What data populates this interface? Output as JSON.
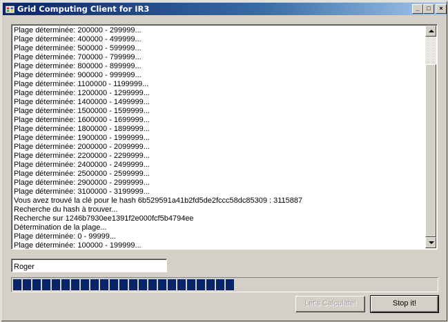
{
  "window": {
    "title": "Grid Computing Client for IR3",
    "controls": {
      "minimize": "_",
      "maximize": "□",
      "close": "×"
    }
  },
  "log": {
    "lines": [
      "Plage déterminée: 200000 - 299999...",
      "Plage déterminée: 400000 - 499999...",
      "Plage déterminée: 500000 - 599999...",
      "Plage déterminée: 700000 - 799999...",
      "Plage déterminée: 800000 - 899999...",
      "Plage déterminée: 900000 - 999999...",
      "Plage déterminée: 1100000 - 1199999...",
      "Plage déterminée: 1200000 - 1299999...",
      "Plage déterminée: 1400000 - 1499999...",
      "Plage déterminée: 1500000 - 1599999...",
      "Plage déterminée: 1600000 - 1699999...",
      "Plage déterminée: 1800000 - 1899999...",
      "Plage déterminée: 1900000 - 1999999...",
      "Plage déterminée: 2000000 - 2099999...",
      "Plage déterminée: 2200000 - 2299999...",
      "Plage déterminée: 2400000 - 2499999...",
      "Plage déterminée: 2500000 - 2599999...",
      "Plage déterminée: 2900000 - 2999999...",
      "Plage déterminée: 3100000 - 3199999...",
      "Vous avez trouvé la clé pour le hash 6b529591a41b2fd5de2fccc58dc85309 : 3115887",
      "Recherche du hash à trouver...",
      "Recherche sur 1246b7930ee1391f2e000fcf5b4794ee",
      "Détermination de la plage...",
      "Plage déterminée: 0 - 99999...",
      "Plage déterminée: 100000 - 199999..."
    ]
  },
  "name_input": {
    "value": "Roger"
  },
  "progress": {
    "fraction": 0.52,
    "color": "#0a246a"
  },
  "buttons": {
    "calculate_label": "Let's Calculate!",
    "calculate_enabled": false,
    "stop_label": "Stop it!"
  },
  "icons": [
    "app-icon",
    "scroll-up-arrow-icon",
    "scroll-down-arrow-icon"
  ]
}
